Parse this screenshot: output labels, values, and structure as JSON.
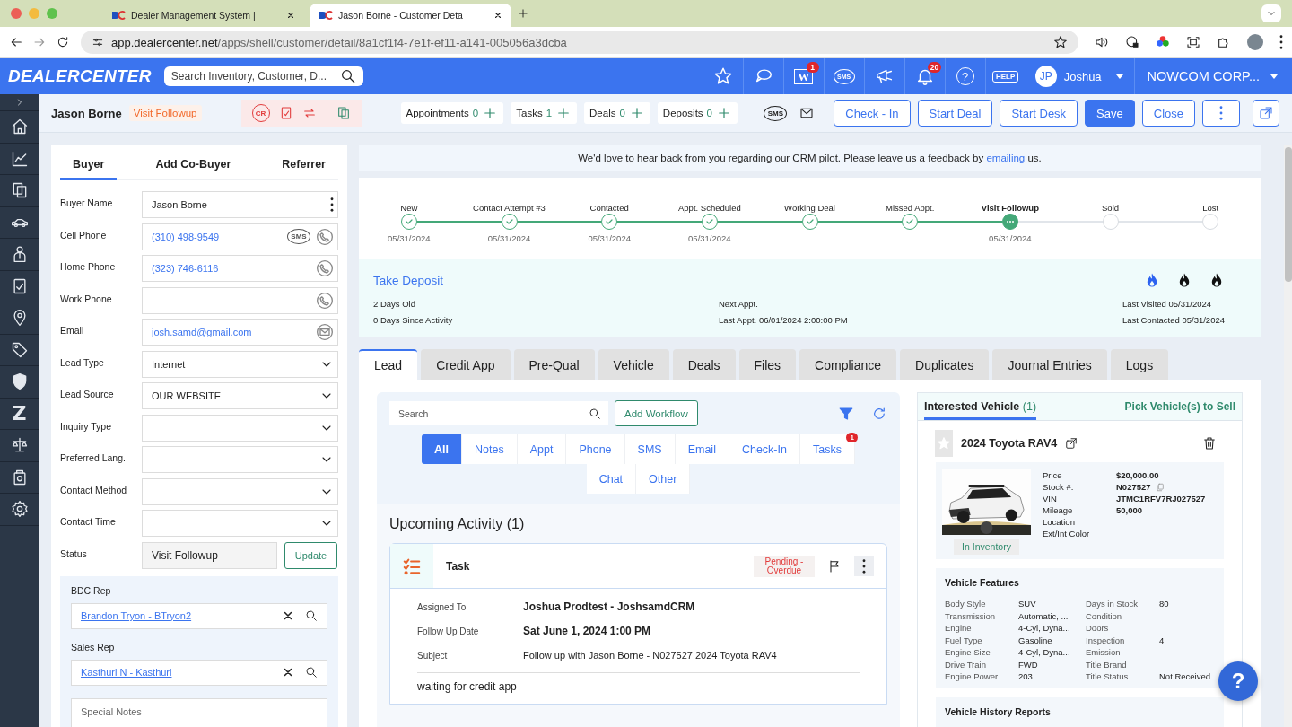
{
  "browser": {
    "tabs": [
      {
        "title": "Dealer Management System |",
        "selected": false
      },
      {
        "title": "Jason Borne - Customer Deta",
        "selected": true
      }
    ],
    "url_host": "app.dealercenter.net",
    "url_path": "/apps/shell/customer/detail/8a1cf1f4-7e1f-ef11-a141-005056a3dcba"
  },
  "header": {
    "logo": "DEALERCENTER",
    "search_placeholder": "Search Inventory, Customer, D...",
    "icons": [
      {
        "kind": "star"
      },
      {
        "kind": "chat"
      },
      {
        "kind": "w",
        "label": "W",
        "badge": "1"
      },
      {
        "kind": "sms",
        "label": "SMS"
      },
      {
        "kind": "megaphone"
      },
      {
        "kind": "bell",
        "badge": "20"
      },
      {
        "kind": "question",
        "label": "?"
      },
      {
        "kind": "help",
        "label": "HELP"
      }
    ],
    "user": {
      "initials": "JP",
      "name": "Joshua"
    },
    "org": "NOWCOM CORP..."
  },
  "sidebar": {
    "items": [
      {
        "kind": "expand"
      },
      {
        "kind": "home"
      },
      {
        "kind": "chart"
      },
      {
        "kind": "documents"
      },
      {
        "kind": "car"
      },
      {
        "kind": "person"
      },
      {
        "kind": "checklist"
      },
      {
        "kind": "money-pin"
      },
      {
        "kind": "tag"
      },
      {
        "kind": "shield"
      },
      {
        "kind": "z",
        "label": "Z"
      },
      {
        "kind": "scales"
      },
      {
        "kind": "money-doc"
      },
      {
        "kind": "gear"
      }
    ]
  },
  "subheader": {
    "name": "Jason Borne",
    "status": "Visit Followup",
    "tools": [
      {
        "kind": "cr",
        "label": "CR"
      },
      {
        "kind": "checklist"
      },
      {
        "kind": "swap"
      },
      {
        "kind": "documents"
      }
    ],
    "counters": [
      {
        "label": "Appointments",
        "count": "0"
      },
      {
        "label": "Tasks",
        "count": "1"
      },
      {
        "label": "Deals",
        "count": "0"
      },
      {
        "label": "Deposits",
        "count": "0"
      }
    ],
    "contact_icons": [
      {
        "kind": "sms",
        "label": "SMS"
      },
      {
        "kind": "mail"
      }
    ],
    "buttons": [
      {
        "label": "Check - In",
        "kind": "outline"
      },
      {
        "label": "Start Deal",
        "kind": "outline"
      },
      {
        "label": "Start Desk",
        "kind": "outline"
      },
      {
        "label": "Save",
        "kind": "primary"
      },
      {
        "label": "Close",
        "kind": "outline"
      },
      {
        "kind": "more"
      },
      {
        "kind": "external"
      }
    ]
  },
  "customer": {
    "tabs": [
      {
        "label": "Buyer",
        "selected": true
      },
      {
        "label": "Add Co-Buyer",
        "selected": false
      },
      {
        "label": "Referrer",
        "selected": false
      }
    ],
    "fields": [
      {
        "label": "Buyer Name",
        "kind": "name",
        "value": "Jason Borne"
      },
      {
        "label": "Cell Phone",
        "kind": "phone",
        "value": "(310) 498-9549",
        "sms": "SMS"
      },
      {
        "label": "Home Phone",
        "kind": "phone",
        "value": "(323) 746-6116"
      },
      {
        "label": "Work Phone",
        "kind": "phone"
      },
      {
        "label": "Email",
        "kind": "email",
        "value": "josh.samd@gmail.com"
      },
      {
        "label": "Lead Type",
        "kind": "select",
        "value": "Internet"
      },
      {
        "label": "Lead Source",
        "kind": "select",
        "value": "OUR WEBSITE"
      },
      {
        "label": "Inquiry Type",
        "kind": "select"
      },
      {
        "label": "Preferred Lang.",
        "kind": "select"
      },
      {
        "label": "Contact Method",
        "kind": "select"
      },
      {
        "label": "Contact Time",
        "kind": "select"
      },
      {
        "label": "Status",
        "kind": "status",
        "value": "Visit Followup",
        "button": "Update"
      }
    ],
    "reps": [
      {
        "label": "BDC Rep",
        "value": "Brandon Tryon - BTryon2"
      },
      {
        "label": "Sales Rep",
        "value": "Kasthuri N - Kasthuri"
      }
    ],
    "notes_placeholder": "Special Notes"
  },
  "banner": {
    "before": "We'd love to hear back from you regarding our CRM pilot. Please leave us a feedback by",
    "link": "emailing",
    "after": "us."
  },
  "pipeline": [
    {
      "label": "New",
      "date": "05/31/2024",
      "kind": "done"
    },
    {
      "label": "Contact Attempt #3",
      "date": "05/31/2024",
      "kind": "done"
    },
    {
      "label": "Contacted",
      "date": "05/31/2024",
      "kind": "done"
    },
    {
      "label": "Appt. Scheduled",
      "date": "05/31/2024",
      "kind": "done"
    },
    {
      "label": "Working Deal",
      "kind": "done"
    },
    {
      "label": "Missed Appt.",
      "kind": "done"
    },
    {
      "label": "Visit Followup",
      "date": "05/31/2024",
      "kind": "current"
    },
    {
      "label": "Sold",
      "kind": "pending"
    },
    {
      "label": "Lost",
      "kind": "pending"
    }
  ],
  "summary": {
    "title": "Take Deposit",
    "flames": [
      {
        "selected": true
      },
      {
        "selected": false
      },
      {
        "selected": false
      }
    ],
    "columns": [
      [
        "2 Days Old",
        "0 Days Since Activity"
      ],
      [
        "Next Appt.",
        "Last Appt. 06/01/2024 2:00:00 PM"
      ],
      [
        "Last Visited 05/31/2024",
        "Last Contacted 05/31/2024"
      ]
    ]
  },
  "tabs": [
    {
      "label": "Lead",
      "selected": true
    },
    {
      "label": "Credit App",
      "selected": false
    },
    {
      "label": "Pre-Qual",
      "selected": false
    },
    {
      "label": "Vehicle",
      "selected": false
    },
    {
      "label": "Deals",
      "selected": false
    },
    {
      "label": "Files",
      "selected": false
    },
    {
      "label": "Compliance",
      "selected": false
    },
    {
      "label": "Duplicates",
      "selected": false
    },
    {
      "label": "Journal Entries",
      "selected": false
    },
    {
      "label": "Logs",
      "selected": false
    }
  ],
  "activity": {
    "search_placeholder": "Search",
    "add_button": "Add Workflow",
    "filters": [
      {
        "label": "All",
        "selected": true
      },
      {
        "label": "Notes",
        "selected": false
      },
      {
        "label": "Appt",
        "selected": false
      },
      {
        "label": "Phone",
        "selected": false
      },
      {
        "label": "SMS",
        "selected": false
      },
      {
        "label": "Email",
        "selected": false
      },
      {
        "label": "Check-In",
        "selected": false
      },
      {
        "label": "Tasks",
        "selected": false,
        "badge": "1"
      },
      {
        "label": "Chat",
        "selected": false
      },
      {
        "label": "Other",
        "selected": false
      }
    ],
    "heading": "Upcoming Activity (1)",
    "task": {
      "type": "Task",
      "status": "Pending - Overdue",
      "fields": [
        {
          "label": "Assigned To",
          "value": "Joshua Prodtest - JoshsamdCRM",
          "kind": "bold"
        },
        {
          "label": "Follow Up Date",
          "value": "Sat June 1, 2024 1:00 PM",
          "kind": "bold"
        },
        {
          "label": "Subject",
          "value": "Follow up with Jason Borne - N027527 2024 Toyota RAV4",
          "kind": "plain"
        }
      ],
      "note": "waiting for credit app"
    }
  },
  "vehicle": {
    "heading": "Interested Vehicle",
    "count": "(1)",
    "action": "Pick Vehicle(s) to Sell",
    "title": "2024 Toyota RAV4",
    "inventory": "In Inventory",
    "specs": [
      {
        "label": "Price",
        "value": "$20,000.00"
      },
      {
        "label": "Stock #:",
        "value": "N027527",
        "copy": true
      },
      {
        "label": "VIN",
        "value": "JTMC1RFV7RJ027527"
      },
      {
        "label": "Mileage",
        "value": "50,000"
      },
      {
        "label": "Location"
      },
      {
        "label": "Ext/Int Color"
      }
    ],
    "features_heading": "Vehicle Features",
    "features": [
      {
        "label": "Body Style",
        "value": "SUV"
      },
      {
        "label": "Days in Stock",
        "value": "80"
      },
      {
        "label": "Transmission",
        "value": "Automatic, ..."
      },
      {
        "label": "Condition"
      },
      {
        "label": "Engine",
        "value": "4-Cyl, Dyna..."
      },
      {
        "label": "Doors"
      },
      {
        "label": "Fuel Type",
        "value": "Gasoline"
      },
      {
        "label": "Inspection",
        "value": "4"
      },
      {
        "label": "Engine Size",
        "value": "4-Cyl, Dyna..."
      },
      {
        "label": "Emission"
      },
      {
        "label": "Drive Train",
        "value": "FWD"
      },
      {
        "label": "Title Brand"
      },
      {
        "label": "Engine Power",
        "value": "203"
      },
      {
        "label": "Title Status",
        "value": "Not Received"
      }
    ],
    "history_heading": "Vehicle History Reports"
  },
  "help_label": "?"
}
